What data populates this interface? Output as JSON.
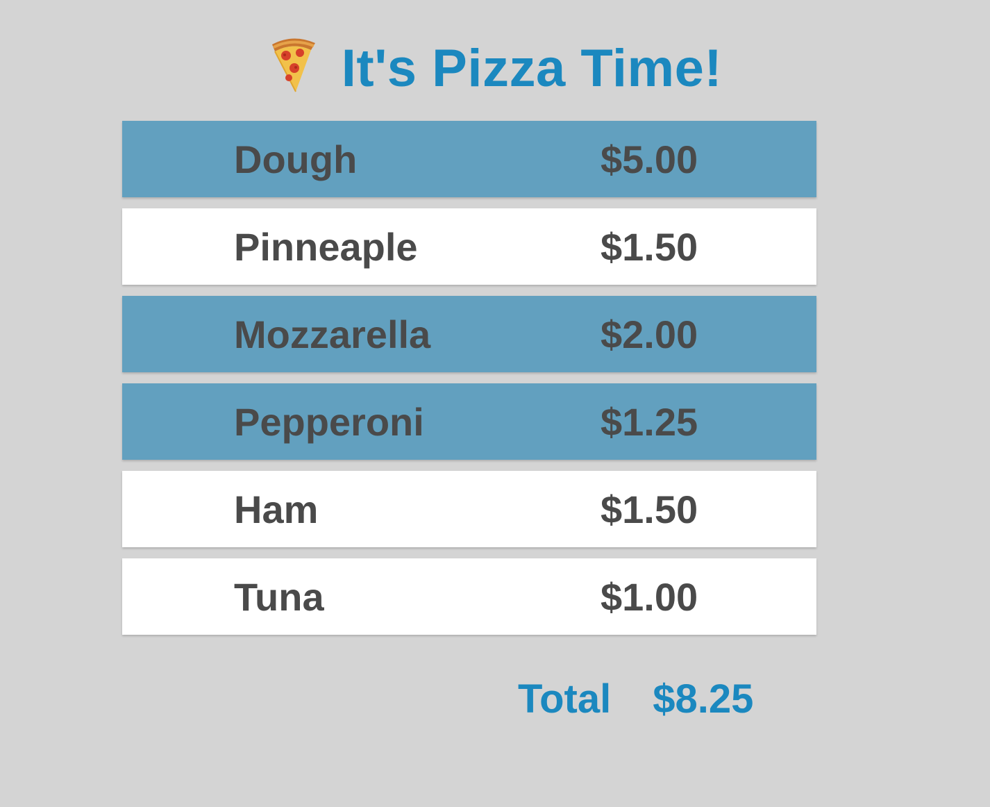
{
  "header": {
    "icon": "pizza-slice-icon",
    "title": "It's Pizza Time!"
  },
  "colors": {
    "background": "#d4d4d4",
    "accent": "#1b88bf",
    "selected_row": "#62a0bf",
    "unselected_row": "#ffffff",
    "row_text": "#4a4a4a"
  },
  "ingredients": [
    {
      "name": "Dough",
      "price": "$5.00",
      "selected": true
    },
    {
      "name": "Pinneaple",
      "price": "$1.50",
      "selected": false
    },
    {
      "name": "Mozzarella",
      "price": "$2.00",
      "selected": true
    },
    {
      "name": "Pepperoni",
      "price": "$1.25",
      "selected": true
    },
    {
      "name": "Ham",
      "price": "$1.50",
      "selected": false
    },
    {
      "name": "Tuna",
      "price": "$1.00",
      "selected": false
    }
  ],
  "total": {
    "label": "Total",
    "value": "$8.25"
  }
}
